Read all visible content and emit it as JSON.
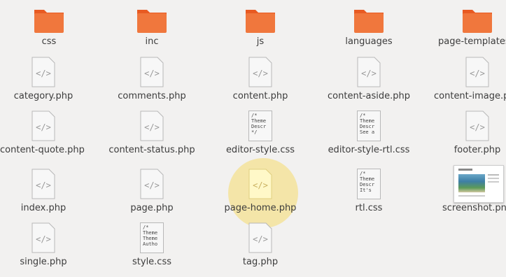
{
  "files": [
    {
      "name": "css",
      "type": "folder"
    },
    {
      "name": "inc",
      "type": "folder"
    },
    {
      "name": "js",
      "type": "folder"
    },
    {
      "name": "languages",
      "type": "folder"
    },
    {
      "name": "page-templates",
      "type": "folder"
    },
    {
      "name": "category.php",
      "type": "php"
    },
    {
      "name": "comments.php",
      "type": "php"
    },
    {
      "name": "content.php",
      "type": "php"
    },
    {
      "name": "content-aside.php",
      "type": "php"
    },
    {
      "name": "content-image.php",
      "type": "php"
    },
    {
      "name": "content-quote.php",
      "type": "php"
    },
    {
      "name": "content-status.php",
      "type": "php"
    },
    {
      "name": "editor-style.css",
      "type": "css",
      "preview": "/*\nTheme\nDescr\n*/"
    },
    {
      "name": "editor-style-rtl.css",
      "type": "css",
      "preview": "/*\nTheme\nDescr\nSee a"
    },
    {
      "name": "footer.php",
      "type": "php"
    },
    {
      "name": "index.php",
      "type": "php"
    },
    {
      "name": "page.php",
      "type": "php"
    },
    {
      "name": "page-home.php",
      "type": "php"
    },
    {
      "name": "rtl.css",
      "type": "css",
      "preview": "/*\nTheme\nDescr\nIt's"
    },
    {
      "name": "screenshot.png",
      "type": "image"
    },
    {
      "name": "single.php",
      "type": "php"
    },
    {
      "name": "style.css",
      "type": "css",
      "preview": "/*\nTheme\nTheme\nAutho"
    },
    {
      "name": "tag.php",
      "type": "php"
    }
  ],
  "colors": {
    "folder": "#f0773d",
    "folder_top": "#e85a22",
    "doc": "#f7f7f7",
    "highlight": "#f5da6e"
  },
  "icons": {
    "folder": "folder-icon",
    "php": "code-file-icon",
    "css": "text-file-icon",
    "image": "image-file-icon"
  }
}
